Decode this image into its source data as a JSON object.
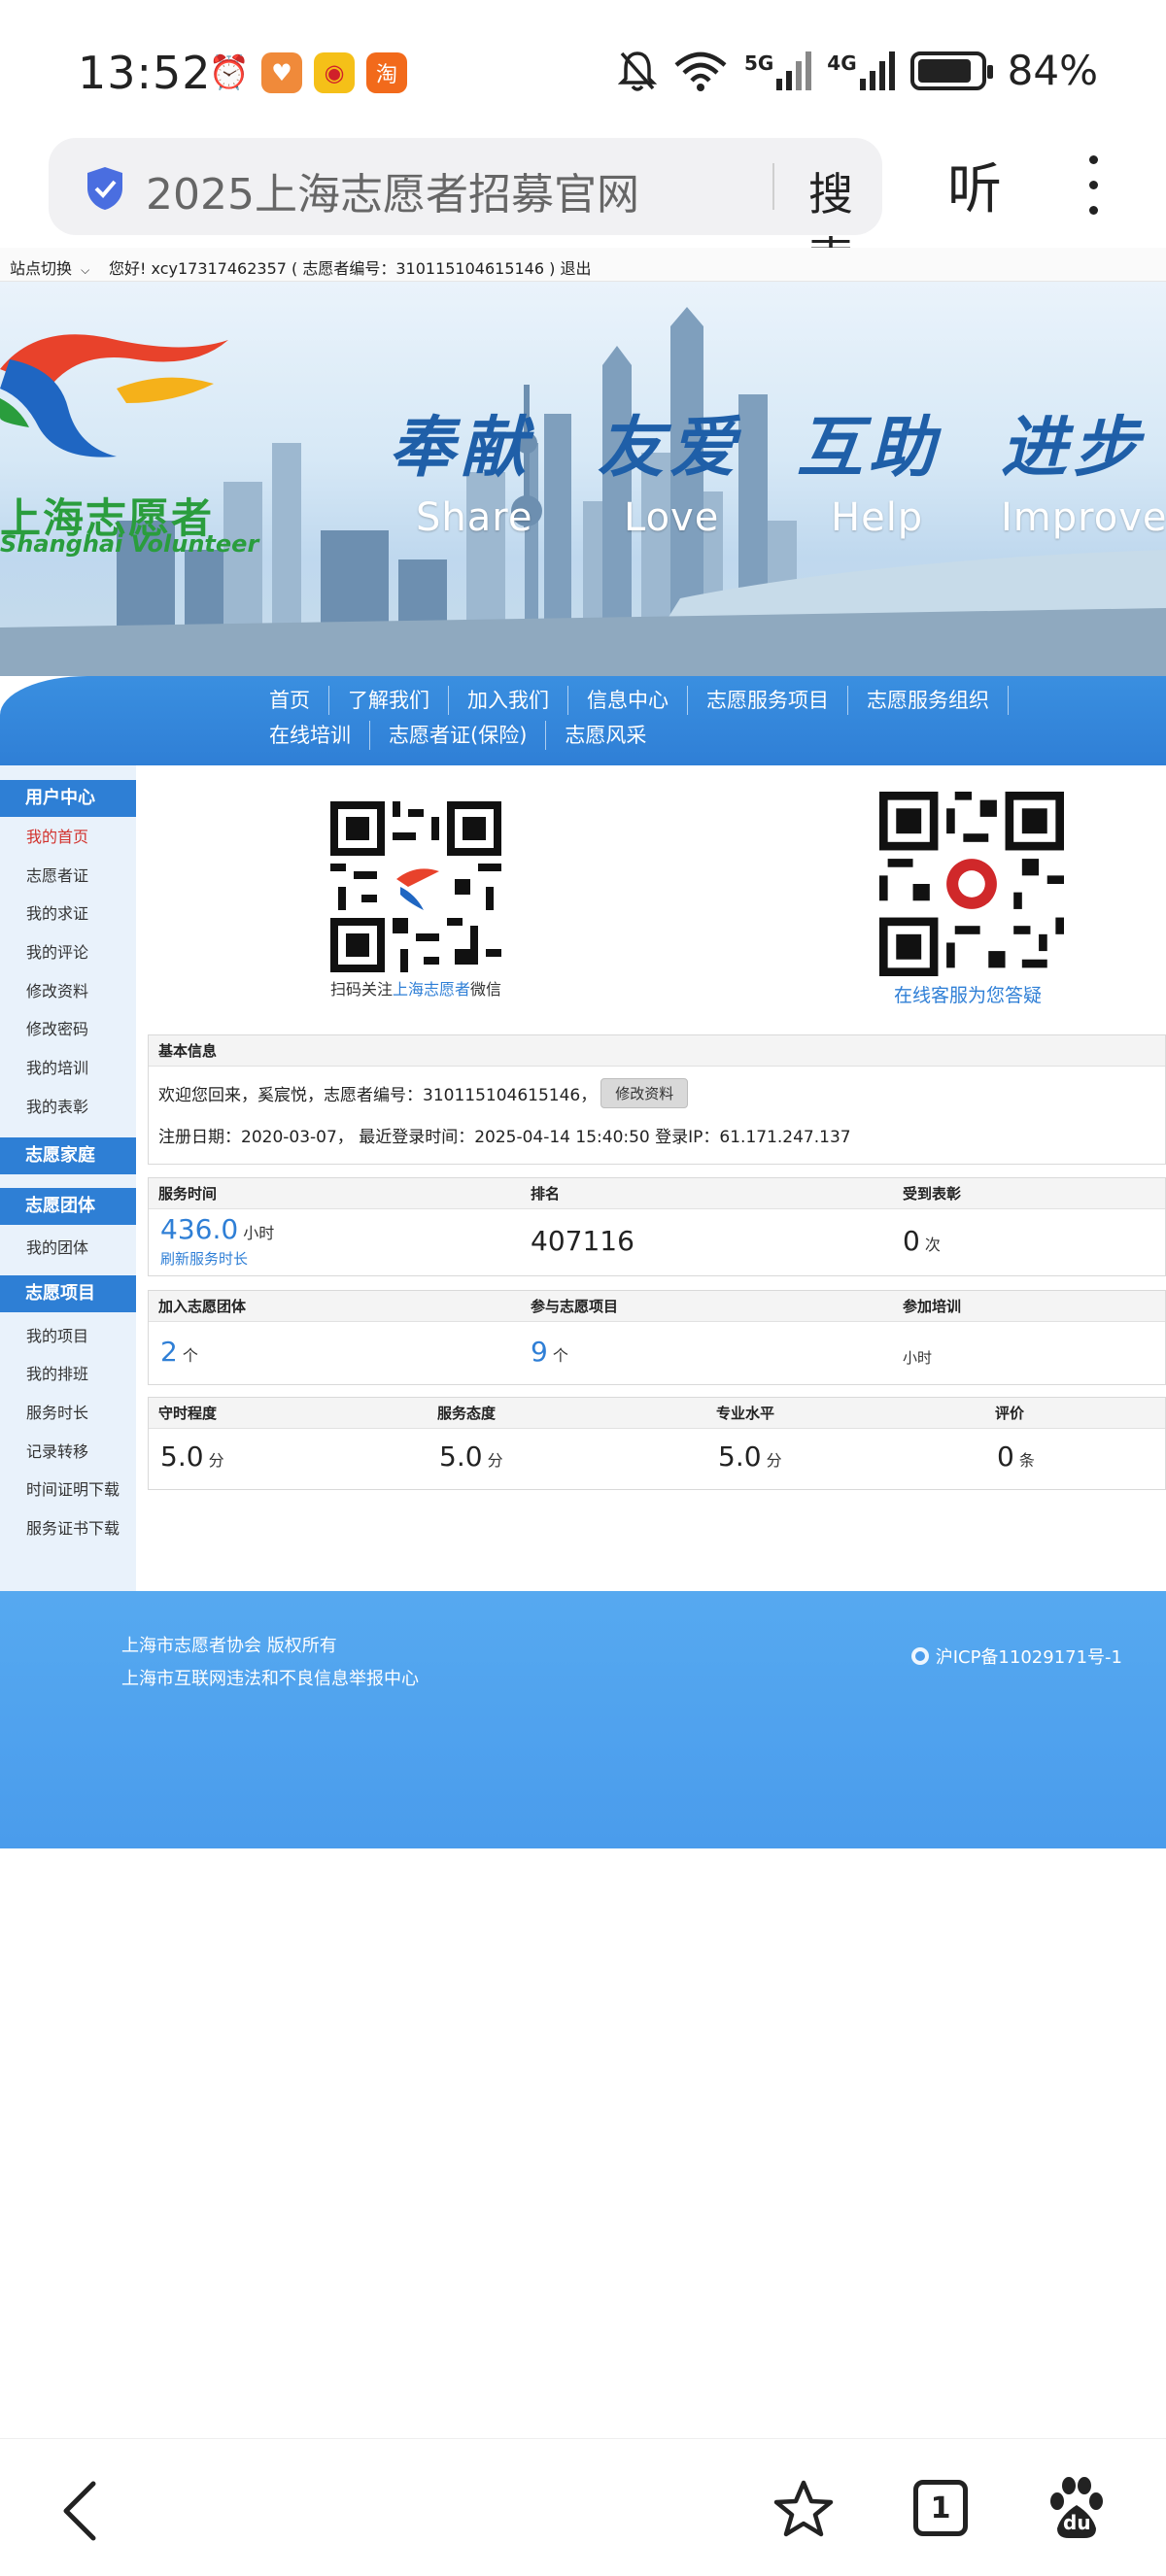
{
  "status_bar": {
    "time": "13:52",
    "battery": "84%",
    "apps": [
      {
        "name": "alarm-icon",
        "glyph": "⏰",
        "color": "#333333"
      },
      {
        "name": "heart-app-icon",
        "glyph": "♥",
        "color": "#f08a3a"
      },
      {
        "name": "weibo-icon",
        "glyph": "◉",
        "color": "#f5c018"
      },
      {
        "name": "taobao-icon",
        "glyph": "淘",
        "color": "#f26a1b"
      }
    ],
    "network": [
      "5G",
      "4G"
    ]
  },
  "browser": {
    "url_title": "2025上海志愿者招募官网",
    "search_label": "搜索",
    "listen_label": "听"
  },
  "site_top": {
    "switch_label": "站点切换",
    "greeting": "您好!  xcy17317462357 ( 志愿者编号：310115104615146 )   退出"
  },
  "banner": {
    "logo_cn": "上海志愿者",
    "logo_en": "Shanghai Volunteer",
    "slogans_cn": [
      "奉献",
      "友爱",
      "互助",
      "进步"
    ],
    "slogans_en": [
      "Share",
      "Love",
      "Help",
      "Improve"
    ]
  },
  "nav": {
    "row1": [
      "首页",
      "了解我们",
      "加入我们",
      "信息中心",
      "志愿服务项目",
      "志愿服务组织"
    ],
    "row2": [
      "在线培训",
      "志愿者证(保险)",
      "志愿风采"
    ]
  },
  "sidebar": {
    "user_center": "用户中心",
    "user_items": [
      "我的首页",
      "志愿者证",
      "我的求证",
      "我的评论",
      "修改资料",
      "修改密码",
      "我的培训",
      "我的表彰"
    ],
    "family": "志愿家庭",
    "team": "志愿团体",
    "team_items": [
      "我的团体"
    ],
    "project": "志愿项目",
    "project_items": [
      "我的项目",
      "我的排班",
      "服务时长",
      "记录转移",
      "时间证明下载",
      "服务证书下载"
    ]
  },
  "qr": {
    "left_caption_pre": "扫码关注",
    "left_caption_link": "上海志愿者",
    "left_caption_post": "微信",
    "right_caption": "在线客服为您答疑"
  },
  "basic_info": {
    "head": "基本信息",
    "welcome": "欢迎您回来，奚宸悦，志愿者编号：310115104615146，",
    "edit_button": "修改资料",
    "reg_line": "注册日期：2020-03-07，  最近登录时间：2025-04-14 15:40:50    登录IP：61.171.247.137"
  },
  "stats1": {
    "service_time_label": "服务时间",
    "service_time_value": "436.0",
    "service_time_unit": "小时",
    "refresh_label": "刷新服务时长",
    "rank_label": "排名",
    "rank_value": "407116",
    "award_label": "受到表彰",
    "award_value": "0",
    "award_unit": "次"
  },
  "stats2": {
    "team_label": "加入志愿团体",
    "team_value": "2",
    "team_unit": "个",
    "project_label": "参与志愿项目",
    "project_value": "9",
    "project_unit": "个",
    "training_label": "参加培训",
    "training_unit": "小时"
  },
  "stats3": {
    "punctual_label": "守时程度",
    "punctual_value": "5.0",
    "attitude_label": "服务态度",
    "attitude_value": "5.0",
    "skill_label": "专业水平",
    "skill_value": "5.0",
    "score_unit": "分",
    "review_label": "评价",
    "review_value": "0",
    "review_unit": "条"
  },
  "footer": {
    "line1": "上海市志愿者协会 版权所有",
    "line2": "上海市互联网违法和不良信息举报中心",
    "icp": "沪ICP备11029171号-1"
  },
  "bottom_bar": {
    "tab_count": "1",
    "baidu_label": "du"
  }
}
